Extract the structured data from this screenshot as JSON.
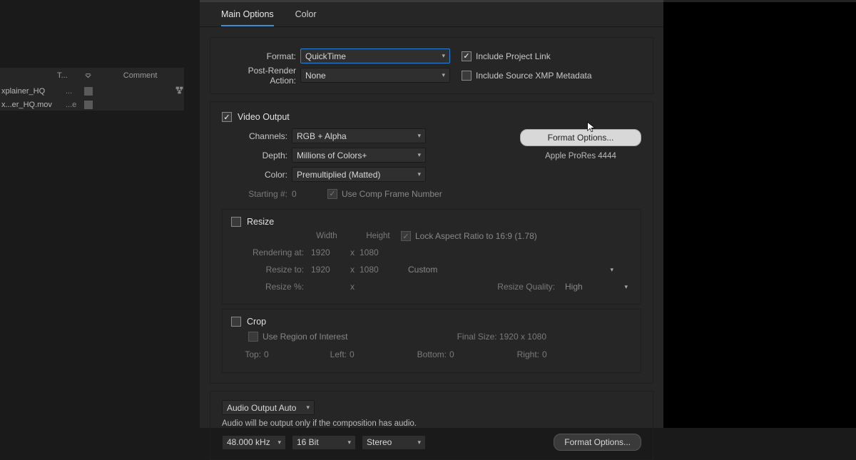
{
  "project": {
    "col1": "T...",
    "col2": "Comment",
    "items": [
      {
        "name": "xplainer_HQ",
        "ext": "..."
      },
      {
        "name": "x...er_HQ.mov",
        "ext": "...e"
      }
    ]
  },
  "tabs": {
    "main": "Main Options",
    "color": "Color"
  },
  "format": {
    "label": "Format:",
    "value": "QuickTime",
    "post_label": "Post-Render Action:",
    "post_value": "None",
    "include_link": "Include Project Link",
    "include_xmp": "Include Source XMP Metadata"
  },
  "video": {
    "header": "Video Output",
    "channels_label": "Channels:",
    "channels_value": "RGB + Alpha",
    "depth_label": "Depth:",
    "depth_value": "Millions of Colors+",
    "color_label": "Color:",
    "color_value": "Premultiplied (Matted)",
    "starting_label": "Starting #:",
    "starting_value": "0",
    "use_comp": "Use Comp Frame Number",
    "format_options_btn": "Format Options...",
    "codec": "Apple ProRes 4444"
  },
  "resize": {
    "header": "Resize",
    "width": "Width",
    "height": "Height",
    "lock": "Lock Aspect Ratio to 16:9 (1.78)",
    "rendering_label": "Rendering at:",
    "rendering_w": "1920",
    "rendering_h": "1080",
    "resize_to_label": "Resize to:",
    "resize_w": "1920",
    "resize_h": "1080",
    "preset": "Custom",
    "resize_pct_label": "Resize %:",
    "quality_label": "Resize Quality:",
    "quality_value": "High",
    "x": "x"
  },
  "crop": {
    "header": "Crop",
    "roi": "Use Region of Interest",
    "final_label": "Final Size: 1920 x 1080",
    "top": "Top:",
    "top_v": "0",
    "left": "Left:",
    "left_v": "0",
    "bottom": "Bottom:",
    "bottom_v": "0",
    "right": "Right:",
    "right_v": "0"
  },
  "audio": {
    "mode": "Audio Output Auto",
    "note": "Audio will be output only if the composition has audio.",
    "rate": "48.000 kHz",
    "depth": "16 Bit",
    "channels": "Stereo",
    "format_options_btn": "Format Options..."
  }
}
